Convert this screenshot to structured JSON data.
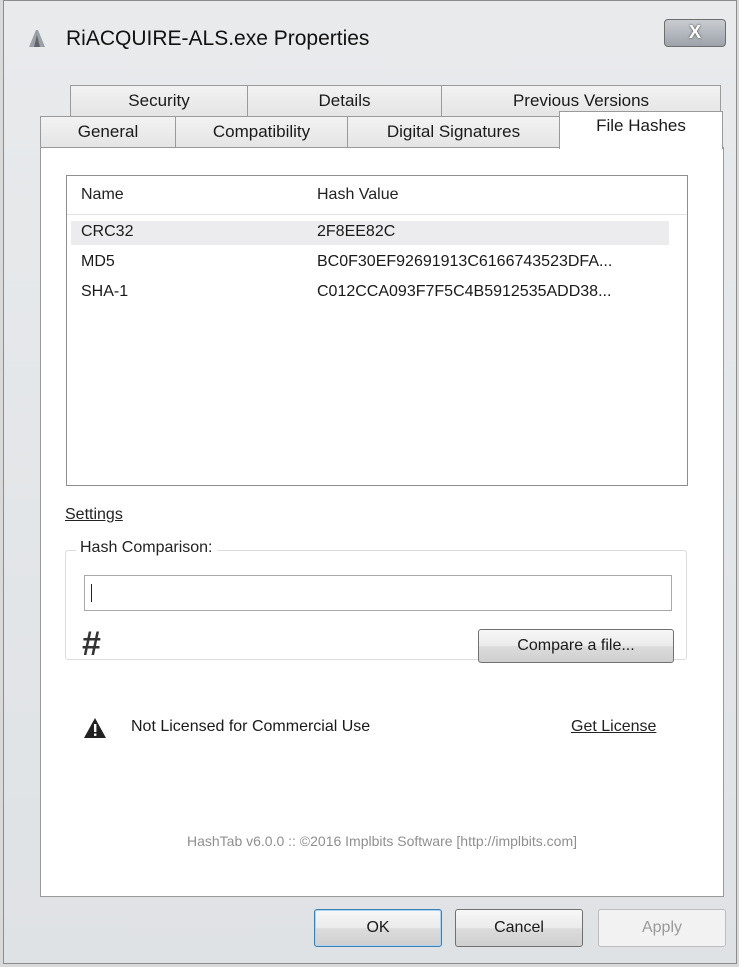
{
  "window": {
    "title": "RiACQUIRE-ALS.exe Properties",
    "close_label": "X"
  },
  "tabs_row1": [
    "Security",
    "Details",
    "Previous Versions"
  ],
  "tabs_row2": [
    "General",
    "Compatibility",
    "Digital Signatures",
    "File Hashes"
  ],
  "active_tab": "File Hashes",
  "hash_list": {
    "columns": [
      "Name",
      "Hash Value"
    ],
    "rows": [
      {
        "name": "CRC32",
        "hash": "2F8EE82C",
        "selected": true
      },
      {
        "name": "MD5",
        "hash": "BC0F30EF92691913C6166743523DFA..."
      },
      {
        "name": "SHA-1",
        "hash": "C012CCA093F7F5C4B5912535ADD38..."
      }
    ]
  },
  "settings_link": "Settings",
  "comparison": {
    "label": "Hash Comparison:",
    "value": "",
    "icon": "hash-icon",
    "compare_button": "Compare a file..."
  },
  "license": {
    "warning_icon": "warning-icon",
    "text": "Not Licensed for Commercial Use",
    "link": "Get License"
  },
  "footer": "HashTab v6.0.0 :: ©2016 Implbits Software [http://implbits.com]",
  "buttons": {
    "ok": "OK",
    "cancel": "Cancel",
    "apply": "Apply"
  }
}
